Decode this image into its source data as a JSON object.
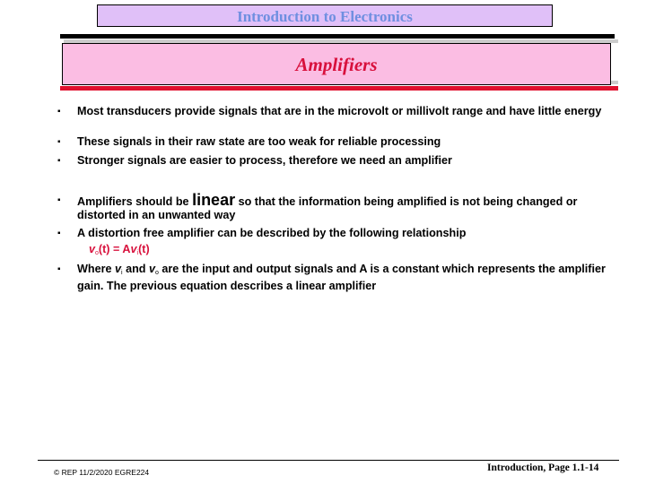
{
  "header": {
    "course_title": "Introduction to Electronics",
    "slide_title": "Amplifiers"
  },
  "colors": {
    "banner_bg": "#e0c0f8",
    "banner_text": "#6f8fe0",
    "title_bg": "#fbbde3",
    "title_text": "#d8103c",
    "accent_red": "#e0102e",
    "formula_text": "#d8103c"
  },
  "bullets": [
    {
      "marker": "▪",
      "text": "Most transducers provide signals that are in the microvolt or millivolt range and have little energy"
    },
    {
      "marker": "▪",
      "text": "These signals in their raw state are too weak for reliable processing"
    },
    {
      "marker": "▪",
      "text": "Stronger signals are easier to process, therefore we need an amplifier"
    },
    {
      "marker": "▪",
      "before": "Amplifiers should be ",
      "emphasis": "linear",
      "after": " so that the information being amplified is not being changed or distorted in an unwanted way"
    },
    {
      "marker": "▪",
      "text": "A distortion free amplifier can be described by the following relationship"
    },
    {
      "marker": "▪",
      "part1": "Where ",
      "var1": "v",
      "sub1": "i",
      "part2": " and ",
      "var2": "v",
      "sub2": "o",
      "part3": " are the input and output signals and A is a constant which represents the amplifier gain. The previous equation describes a linear amplifier"
    }
  ],
  "formula": {
    "lhs_var": "v",
    "lhs_sub": "o",
    "lhs_rest": "(t) = A",
    "rhs_var": "v",
    "rhs_sub": "i",
    "rhs_rest": "(t)"
  },
  "footer": {
    "left": "© REP  11/2/2020  EGRE224",
    "right": "Introduction, Page 1.1-14"
  }
}
